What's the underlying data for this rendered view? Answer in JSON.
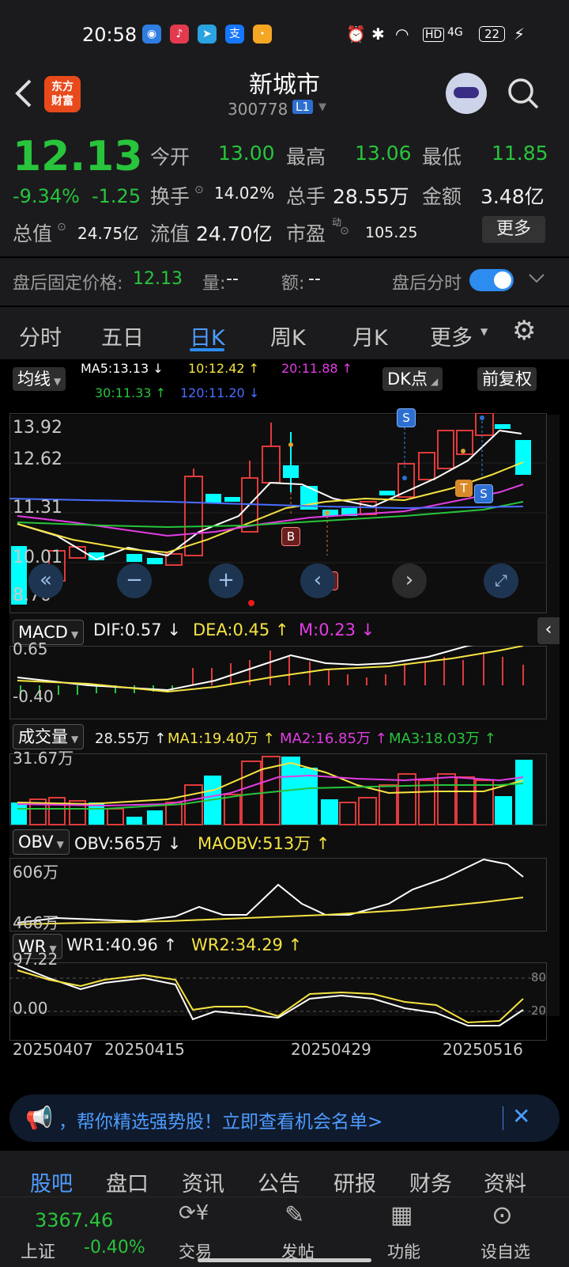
{
  "status_bar": {
    "time": "20:58",
    "battery": "22",
    "network": "4G",
    "hd": "HD"
  },
  "header": {
    "back_icon": "back-arrow-icon",
    "logo_text_1": "东方",
    "logo_text_2": "财富",
    "title": "新城市",
    "code": "300778",
    "level_badge": "L1"
  },
  "quote": {
    "price": "12.13",
    "change_pct": "-9.34%",
    "change_abs": "-1.25",
    "open_label": "今开",
    "open": "13.00",
    "high_label": "最高",
    "high": "13.06",
    "low_label": "最低",
    "low": "11.85",
    "turnover_label": "换手",
    "turnover": "14.02%",
    "volume_label": "总手",
    "volume": "28.55万",
    "amount_label": "金额",
    "amount": "3.48亿",
    "mktcap_label": "总值",
    "mktcap": "24.75亿",
    "float_label": "流值",
    "float_cap": "24.70亿",
    "pe_label": "市盈",
    "pe_sup": "动",
    "pe": "105.25",
    "more_button": "更多"
  },
  "after_hours": {
    "fixed_price_label": "盘后固定价格:",
    "fixed_price": "12.13",
    "qty_label": "量:",
    "qty": "--",
    "amt_label": "额:",
    "amt": "--",
    "toggle_label": "盘后分时",
    "toggle_on": true
  },
  "tabs": [
    "分时",
    "五日",
    "日K",
    "周K",
    "月K",
    "更多"
  ],
  "active_tab": "日K",
  "kline": {
    "ma_select": "均线",
    "ma5": "MA5:13.13 ↓",
    "ma10": "10:12.42 ↑",
    "ma20": "20:11.88 ↑",
    "ma30": "30:11.33 ↑",
    "ma120": "120:11.20 ↓",
    "dk_button": "DK点",
    "adjust_button": "前复权",
    "y_ticks": [
      "13.92",
      "12.62",
      "11.31",
      "10.01",
      "8.70"
    ],
    "markers": [
      "S",
      "S",
      "T",
      "B",
      "B"
    ]
  },
  "macd": {
    "select": "MACD",
    "dif": "DIF:0.57 ↓",
    "dea": "DEA:0.45 ↑",
    "m": "M:0.23 ↓",
    "y_ticks": [
      "0.65",
      "-0.40"
    ]
  },
  "volume": {
    "select": "成交量",
    "vol": "28.55万 ↑",
    "ma1": "MA1:19.40万 ↑",
    "ma2": "MA2:16.85万 ↑",
    "ma3": "MA3:18.03万 ↑",
    "y_tick": "31.67万"
  },
  "obv": {
    "select": "OBV",
    "obv": "OBV:565万 ↓",
    "maobv": "MAOBV:513万 ↑",
    "y_ticks": [
      "606万",
      "466万"
    ]
  },
  "wr": {
    "select": "WR",
    "wr1": "WR1:40.96 ↑",
    "wr2": "WR2:34.29 ↑",
    "y_ticks": [
      "97.22",
      "0.00"
    ],
    "right_ticks": [
      "80",
      "20"
    ]
  },
  "dates": [
    "20250407",
    "20250415",
    "20250429",
    "20250516"
  ],
  "banner": {
    "text": "，帮你精选强势股！立即查看机会名单>"
  },
  "bottom_tabs": [
    "股吧",
    "盘口",
    "资讯",
    "公告",
    "研报",
    "财务",
    "资料"
  ],
  "active_bottom_tab": "股吧",
  "bottom_nav": {
    "index_value": "3367.46",
    "index_name": "上证",
    "index_change": "-0.40%",
    "items": [
      "交易",
      "发帖",
      "功能",
      "设自选"
    ]
  },
  "colors": {
    "up": "#e03a3a",
    "down": "#00ffff",
    "green": "#28c43c",
    "accent": "#2d8cf0"
  }
}
